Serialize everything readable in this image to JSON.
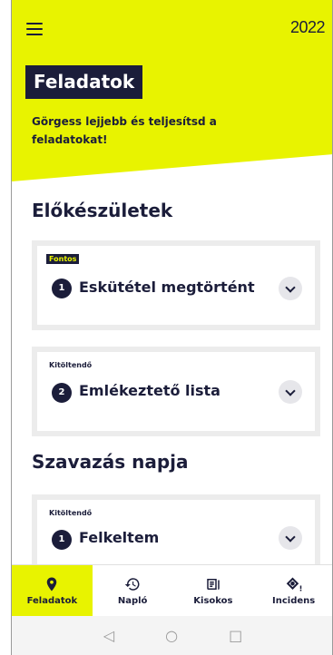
{
  "header": {
    "logo": "2022",
    "title": "Feladatok",
    "subtitle": "Görgess lejjebb és teljesítsd a feladatokat!"
  },
  "sections": [
    {
      "title": "Előkészületek"
    },
    {
      "title": "Szavazás napja"
    }
  ],
  "cards": [
    {
      "badge": "Fontos",
      "number": "1",
      "title": "Eskütétel megtörtént"
    },
    {
      "badge": "Kitöltendő",
      "number": "2",
      "title": "Emlékeztető lista"
    },
    {
      "badge": "Kitöltendő",
      "number": "1",
      "title": "Felkeltem"
    }
  ],
  "bottom_nav": [
    {
      "label": "Feladatok",
      "icon": "location-pin-icon",
      "active": true
    },
    {
      "label": "Napló",
      "icon": "history-icon",
      "active": false
    },
    {
      "label": "Kisokos",
      "icon": "document-icon",
      "active": false
    },
    {
      "label": "Incidens",
      "icon": "alert-diamond-icon",
      "active": false
    }
  ],
  "system_nav": {
    "back": "◁",
    "home": "○",
    "recents": "□"
  },
  "colors": {
    "accent": "#e8f300",
    "primary": "#1b1d3a",
    "card_border": "#ececec"
  }
}
